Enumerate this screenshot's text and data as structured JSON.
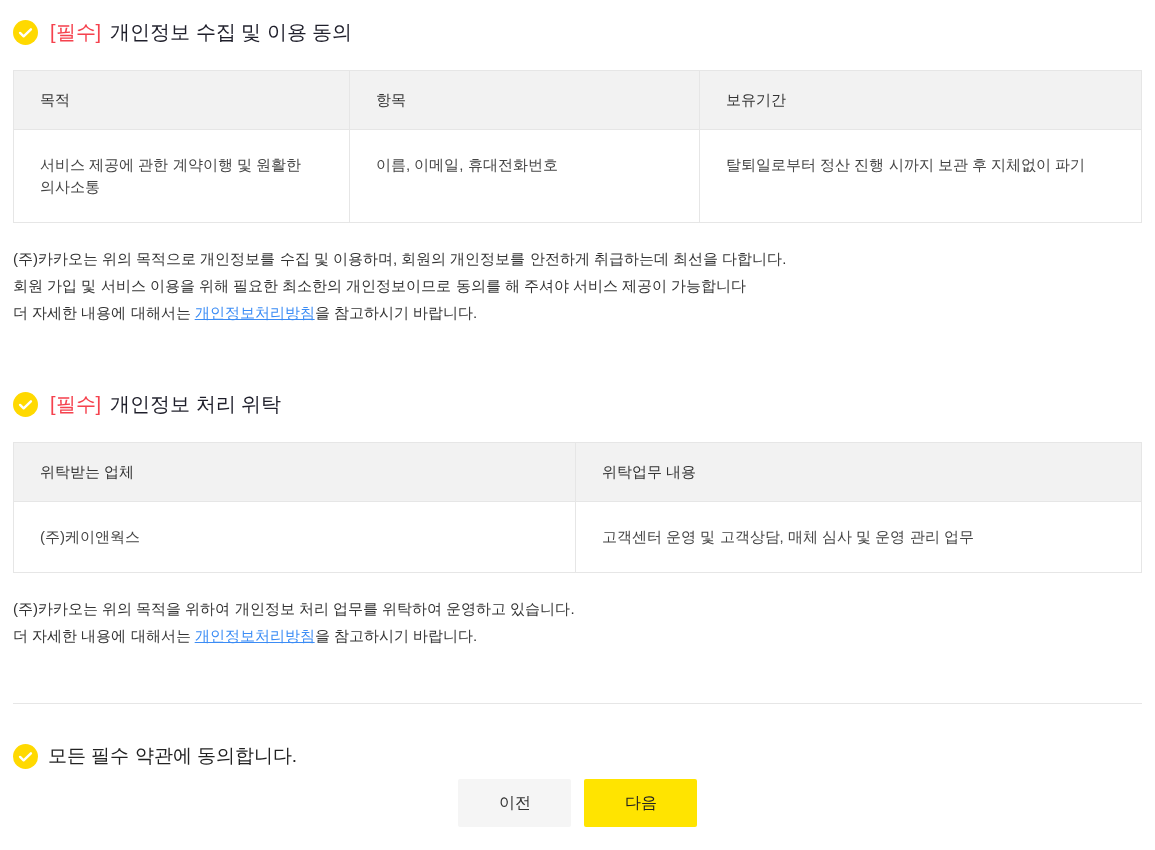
{
  "sections": [
    {
      "checked": true,
      "tag": "[필수]",
      "title": "개인정보 수집 및 이용 동의",
      "table": {
        "columns": [
          "목적",
          "항목",
          "보유기간"
        ],
        "rows": [
          [
            "서비스 제공에 관한 계약이행 및 원활한 의사소통",
            "이름, 이메일, 휴대전화번호",
            "탈퇴일로부터 정산 진행 시까지 보관 후 지체없이 파기"
          ]
        ]
      },
      "notes": [
        [
          {
            "kind": "text",
            "text": "(주)카카오는 위의 목적으로 개인정보를 수집 및 이용하며, 회원의 개인정보를 안전하게 취급하는데 최선을 다합니다."
          }
        ],
        [
          {
            "kind": "text",
            "text": "회원 가입 및 서비스 이용을 위해 필요한 최소한의 개인정보이므로 동의를 해 주셔야 서비스 제공이 가능합니다"
          }
        ],
        [
          {
            "kind": "text",
            "text": "더 자세한 내용에 대해서는 "
          },
          {
            "kind": "link",
            "text": "개인정보처리방침"
          },
          {
            "kind": "text",
            "text": "을 참고하시기 바랍니다."
          }
        ]
      ]
    },
    {
      "checked": true,
      "tag": "[필수]",
      "title": "개인정보 처리 위탁",
      "table": {
        "columns": [
          "위탁받는 업체",
          "위탁업무 내용"
        ],
        "rows": [
          [
            "(주)케이앤웍스",
            "고객센터 운영 및 고객상담, 매체 심사 및 운영 관리 업무"
          ]
        ]
      },
      "notes": [
        [
          {
            "kind": "text",
            "text": "(주)카카오는 위의 목적을 위하여 개인정보 처리 업무를 위탁하여 운영하고 있습니다."
          }
        ],
        [
          {
            "kind": "text",
            "text": "더 자세한 내용에 대해서는 "
          },
          {
            "kind": "link",
            "text": "개인정보처리방침"
          },
          {
            "kind": "text",
            "text": "을 참고하시기 바랍니다."
          }
        ]
      ]
    }
  ],
  "agree_all": {
    "checked": true,
    "label": "모든 필수 약관에 동의합니다."
  },
  "buttons": [
    {
      "kind": "secondary",
      "label": "이전"
    },
    {
      "kind": "primary",
      "label": "다음"
    }
  ]
}
